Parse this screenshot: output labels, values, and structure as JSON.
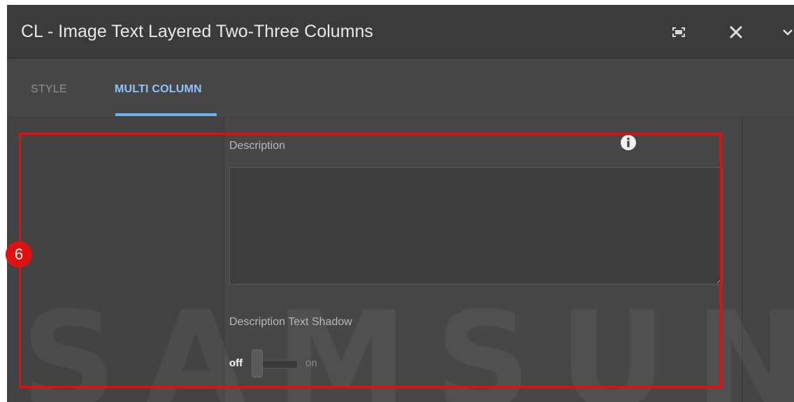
{
  "dialog": {
    "title": "CL - Image Text Layered Two-Three Columns"
  },
  "icons": {
    "fullscreen": "fullscreen-icon",
    "close": "close-icon",
    "chevron": "chevron-down-icon",
    "info": "info-icon"
  },
  "tabs": [
    {
      "label": "STYLE",
      "active": false
    },
    {
      "label": "MULTI COLUMN",
      "active": true
    }
  ],
  "form": {
    "description_label": "Description",
    "description_value": "",
    "shadow_label": "Description Text Shadow",
    "toggle_off": "off",
    "toggle_on": "on",
    "toggle_state": "off"
  },
  "annotation": {
    "number": "6",
    "color": "#e01010"
  },
  "colors": {
    "accent": "#6fb0f2",
    "dialog_bg": "#444444"
  }
}
